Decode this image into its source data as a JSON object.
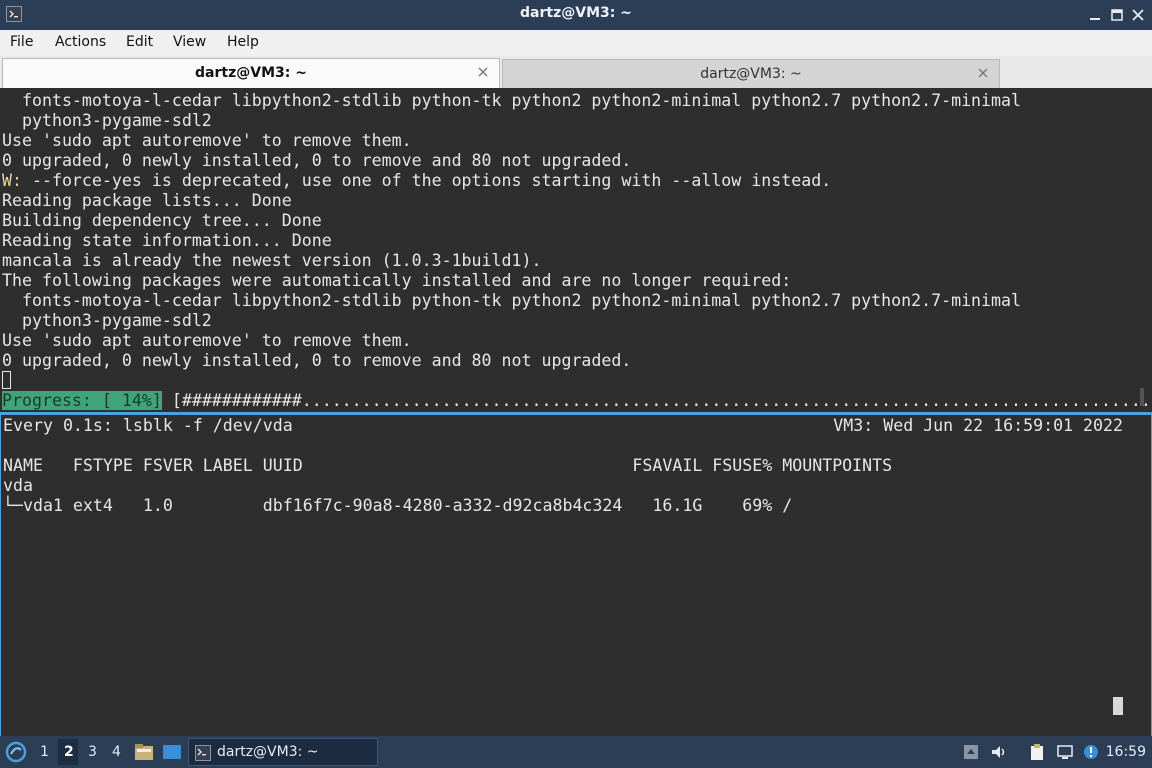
{
  "window": {
    "title": "dartz@VM3: ~"
  },
  "menu": [
    "File",
    "Actions",
    "Edit",
    "View",
    "Help"
  ],
  "tabs": [
    {
      "label": "dartz@VM3: ~",
      "active": true
    },
    {
      "label": "dartz@VM3: ~",
      "active": false
    }
  ],
  "top_pane": {
    "lines": [
      "  fonts-motoya-l-cedar libpython2-stdlib python-tk python2 python2-minimal python2.7 python2.7-minimal",
      "  python3-pygame-sdl2",
      "Use 'sudo apt autoremove' to remove them.",
      "0 upgraded, 0 newly installed, 0 to remove and 80 not upgraded.",
      "Reading package lists... Done",
      "Building dependency tree... Done",
      "Reading state information... Done",
      "mancala is already the newest version (1.0.3-1build1).",
      "The following packages were automatically installed and are no longer required:",
      "  fonts-motoya-l-cedar libpython2-stdlib python-tk python2 python2-minimal python2.7 python2.7-minimal",
      "  python3-pygame-sdl2",
      "Use 'sudo apt autoremove' to remove them.",
      "0 upgraded, 0 newly installed, 0 to remove and 80 not upgraded."
    ],
    "warning": {
      "prefix": "W:",
      "text": " --force-yes is deprecated, use one of the options starting with --allow instead."
    },
    "progress": {
      "label": "Progress: [ 14%]",
      "bar": " [############......................................................................................]",
      "percent": 14
    }
  },
  "bottom_pane": {
    "header_left": "Every 0.1s: lsblk -f /dev/vda",
    "header_right": "VM3: Wed Jun 22 16:59:01 2022",
    "table_header": "NAME   FSTYPE FSVER LABEL UUID                                 FSAVAIL FSUSE% MOUNTPOINTS",
    "rows": [
      "vda",
      "└─vda1 ext4   1.0         dbf16f7c-90a8-4280-a332-d92ca8b4c324   16.1G    69% /"
    ]
  },
  "taskbar": {
    "workspaces": [
      "1",
      "2",
      "3",
      "4"
    ],
    "active_workspace": "2",
    "window_label": "dartz@VM3: ~",
    "clock": "16:59"
  },
  "colors": {
    "titlebar": "#2c3e56",
    "accent": "#4aa3e0",
    "progress": "#3fa47c",
    "terminal_bg": "#2e2e2e"
  }
}
